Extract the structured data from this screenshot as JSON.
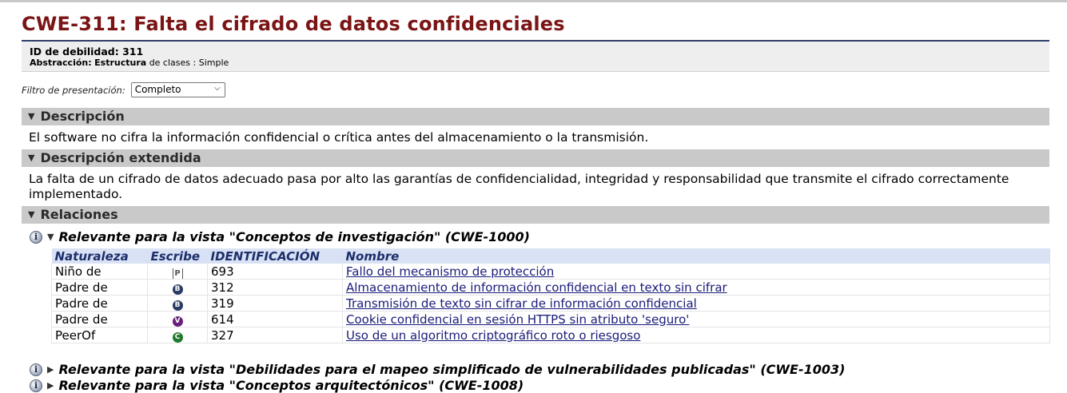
{
  "title": "CWE-311: Falta el cifrado de datos confidenciales",
  "id_line": {
    "label": "ID de debilidad:",
    "value": "311"
  },
  "abstraction": {
    "label": "Abstracción:",
    "value": "Estructura",
    "rest": "de clases : Simple"
  },
  "filter": {
    "label": "Filtro de presentación:",
    "selected": "Completo"
  },
  "sections": {
    "description": {
      "title": "Descripción",
      "text": "El software no cifra la información confidencial o crítica antes del almacenamiento o la transmisión."
    },
    "extended": {
      "title": "Descripción extendida",
      "text": "La falta de un cifrado de datos adecuado pasa por alto las garantías de confidencialidad, integridad y responsabilidad que transmite el cifrado correctamente implementado."
    },
    "relations": {
      "title": "Relaciones"
    }
  },
  "views": [
    {
      "text": "Relevante para la vista \"Conceptos de investigación\" (CWE-1000)",
      "expanded": true
    },
    {
      "text": "Relevante para la vista \"Debilidades para el mapeo simplificado de vulnerabilidades publicadas\" (CWE-1003)",
      "expanded": false
    },
    {
      "text": "Relevante para la vista \"Conceptos arquitectónicos\" (CWE-1008)",
      "expanded": false
    }
  ],
  "table": {
    "headers": [
      "Naturaleza",
      "Escribe",
      "IDENTIFICACIÓN",
      "Nombre"
    ],
    "rows": [
      {
        "nature": "Niño de",
        "type": "P",
        "id": "693",
        "name": "Fallo del mecanismo de protección"
      },
      {
        "nature": "Padre de",
        "type": "B",
        "id": "312",
        "name": "Almacenamiento de información confidencial en texto sin cifrar"
      },
      {
        "nature": "Padre de",
        "type": "B",
        "id": "319",
        "name": "Transmisión de texto sin cifrar de información confidencial"
      },
      {
        "nature": "Padre de",
        "type": "V",
        "id": "614",
        "name": "Cookie confidencial en sesión HTTPS sin atributo 'seguro'"
      },
      {
        "nature": "PeerOf",
        "type": "C",
        "id": "327",
        "name": "Uso de un algoritmo criptográfico roto o riesgoso"
      }
    ]
  },
  "icons": {
    "info": "info-icon",
    "expand": "triangle-down-icon",
    "collapse": "triangle-right-icon"
  },
  "colors": {
    "title": "#7b1414",
    "section_bar": "#c9c9c9",
    "table_header": "#d9e1f4",
    "link": "#1a1a7a"
  }
}
